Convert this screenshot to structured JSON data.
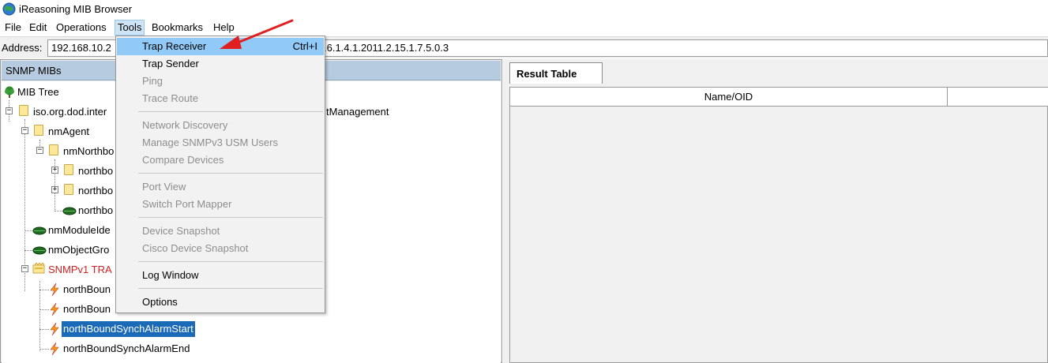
{
  "window": {
    "title": "iReasoning MIB Browser"
  },
  "menubar": [
    "File",
    "Edit",
    "Operations",
    "Tools",
    "Bookmarks",
    "Help"
  ],
  "address": {
    "label": "Address:",
    "value": "192.168.10.2",
    "oid_visible": ".6.1.4.1.2011.2.15.1.7.5.0.3"
  },
  "left_panel": {
    "header": "SNMP MIBs",
    "tree": [
      {
        "label": "MIB Tree",
        "icon": "tree-icon"
      },
      {
        "label": "iso.org.dod.inter",
        "label_tail": "tManagement",
        "icon": "folder-icon"
      },
      {
        "label": "nmAgent",
        "icon": "folder-icon"
      },
      {
        "label": "nmNorthbo",
        "icon": "folder-icon"
      },
      {
        "label": "northbo",
        "icon": "folder-icon"
      },
      {
        "label": "northbo",
        "icon": "folder-icon"
      },
      {
        "label": "northbo",
        "icon": "leaf-icon"
      },
      {
        "label": "nmModuleIde",
        "icon": "leaf-icon"
      },
      {
        "label": "nmObjectGro",
        "icon": "leaf-icon"
      },
      {
        "label": "SNMPv1 TRA",
        "icon": "trap-folder-icon"
      },
      {
        "label": "northBoun",
        "icon": "trap-icon"
      },
      {
        "label": "northBoun",
        "icon": "trap-icon"
      },
      {
        "label": "northBoundSynchAlarmStart",
        "icon": "trap-icon"
      },
      {
        "label": "northBoundSynchAlarmEnd",
        "icon": "trap-icon"
      }
    ]
  },
  "right_panel": {
    "tab": "Result Table",
    "columns": [
      "Name/OID",
      ""
    ]
  },
  "tools_menu": {
    "items": [
      {
        "label": "Trap Receiver",
        "accel": "Ctrl+I",
        "enabled": true,
        "highlighted": true
      },
      {
        "label": "Trap Sender",
        "enabled": true
      },
      {
        "label": "Ping",
        "enabled": false
      },
      {
        "label": "Trace Route",
        "enabled": false
      },
      {
        "label": "Network Discovery",
        "enabled": false
      },
      {
        "label": "Manage SNMPv3 USM Users",
        "enabled": false
      },
      {
        "label": "Compare Devices",
        "enabled": false
      },
      {
        "label": "Port View",
        "enabled": false
      },
      {
        "label": "Switch Port Mapper",
        "enabled": false
      },
      {
        "label": "Device Snapshot",
        "enabled": false
      },
      {
        "label": "Cisco Device Snapshot",
        "enabled": false
      },
      {
        "label": "Log Window",
        "enabled": true
      },
      {
        "label": "Options",
        "enabled": true
      }
    ]
  },
  "colors": {
    "menu_highlight": "#91c9f7",
    "selection": "#1a6ab8",
    "trap_folder_text": "#d42020",
    "annotation_arrow": "#e02020"
  }
}
